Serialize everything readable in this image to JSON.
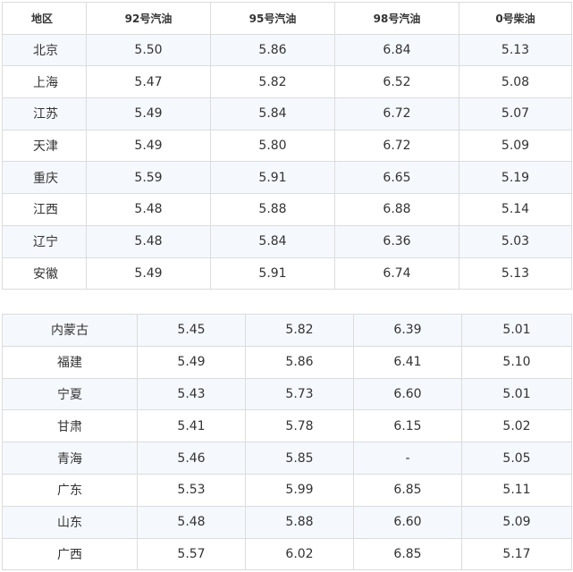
{
  "table1": {
    "headers": [
      "地区",
      "92号汽油",
      "95号汽油",
      "98号汽油",
      "0号柴油"
    ],
    "rows": [
      [
        "北京",
        "5.50",
        "5.86",
        "6.84",
        "5.13"
      ],
      [
        "上海",
        "5.47",
        "5.82",
        "6.52",
        "5.08"
      ],
      [
        "江苏",
        "5.49",
        "5.84",
        "6.72",
        "5.07"
      ],
      [
        "天津",
        "5.49",
        "5.80",
        "6.72",
        "5.09"
      ],
      [
        "重庆",
        "5.59",
        "5.91",
        "6.65",
        "5.19"
      ],
      [
        "江西",
        "5.48",
        "5.88",
        "6.88",
        "5.14"
      ],
      [
        "辽宁",
        "5.48",
        "5.84",
        "6.36",
        "5.03"
      ],
      [
        "安徽",
        "5.49",
        "5.91",
        "6.74",
        "5.13"
      ]
    ]
  },
  "table2": {
    "rows": [
      [
        "内蒙古",
        "5.45",
        "5.82",
        "6.39",
        "5.01"
      ],
      [
        "福建",
        "5.49",
        "5.86",
        "6.41",
        "5.10"
      ],
      [
        "宁夏",
        "5.43",
        "5.73",
        "6.60",
        "5.01"
      ],
      [
        "甘肃",
        "5.41",
        "5.78",
        "6.15",
        "5.02"
      ],
      [
        "青海",
        "5.46",
        "5.85",
        "-",
        "5.05"
      ],
      [
        "广东",
        "5.53",
        "5.99",
        "6.85",
        "5.11"
      ],
      [
        "山东",
        "5.48",
        "5.88",
        "6.60",
        "5.09"
      ],
      [
        "广西",
        "5.57",
        "6.02",
        "6.85",
        "5.17"
      ]
    ]
  }
}
